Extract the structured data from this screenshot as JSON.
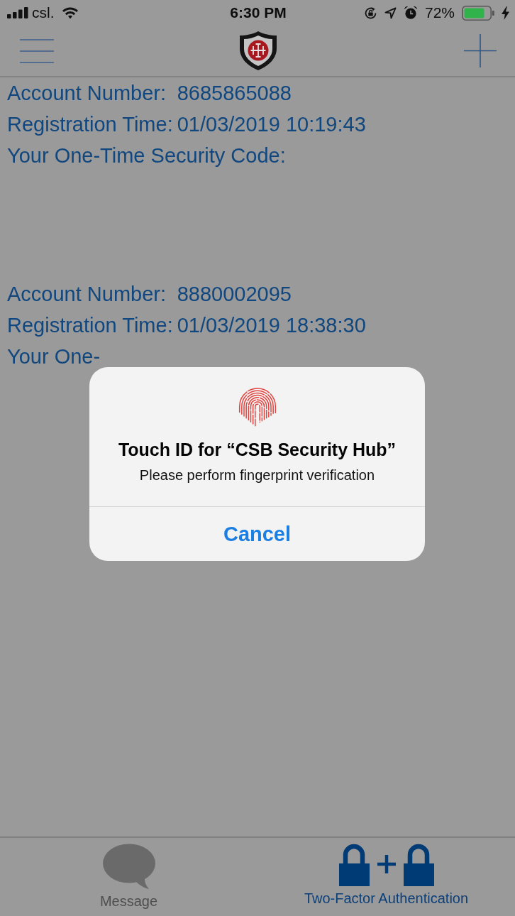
{
  "status_bar": {
    "carrier": "csl.",
    "time": "6:30 PM",
    "battery": "72%"
  },
  "accounts": [
    {
      "fields": [
        {
          "label": "Account Number:",
          "value": "8685865088"
        },
        {
          "label": "Registration Time:",
          "value": "01/03/2019 10:19:43"
        },
        {
          "label": "Your One-Time Security Code:"
        }
      ]
    },
    {
      "fields": [
        {
          "label": "Account Number:",
          "value": "8880002095"
        },
        {
          "label": "Registration Time:",
          "value": "01/03/2019 18:38:30"
        },
        {
          "label": "Your One-"
        }
      ]
    }
  ],
  "touch_id_dialog": {
    "title": "Touch ID for “CSB Security Hub”",
    "message": "Please perform fingerprint verification",
    "button": "Cancel"
  },
  "tabs": [
    {
      "label": "Message",
      "kind": "message",
      "selected": false
    },
    {
      "label": "Two-Factor Authentication",
      "kind": "locks",
      "selected": true
    }
  ]
}
